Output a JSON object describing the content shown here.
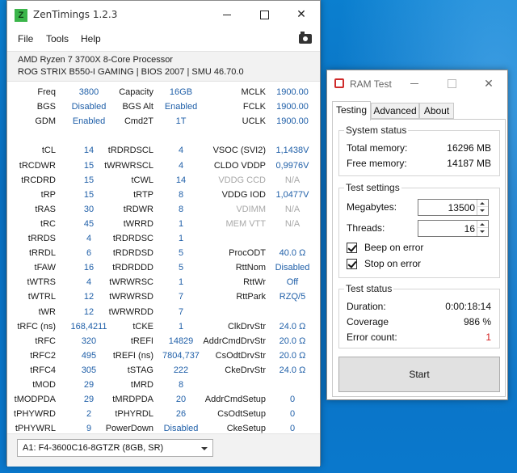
{
  "zentimings": {
    "title": "ZenTimings 1.2.3",
    "logo_letter": "Z",
    "menu": [
      "File",
      "Tools",
      "Help"
    ],
    "cpu": "AMD Ryzen 7 3700X 8-Core Processor",
    "board": "ROG STRIX B550-I GAMING | BIOS 2007 | SMU 46.70.0",
    "col1": [
      {
        "label": "Freq",
        "value": "3800"
      },
      {
        "label": "BGS",
        "value": "Disabled"
      },
      {
        "label": "GDM",
        "value": "Enabled"
      },
      {
        "label": "",
        "value": ""
      },
      {
        "label": "tCL",
        "value": "14"
      },
      {
        "label": "tRCDWR",
        "value": "15"
      },
      {
        "label": "tRCDRD",
        "value": "15"
      },
      {
        "label": "tRP",
        "value": "15"
      },
      {
        "label": "tRAS",
        "value": "30"
      },
      {
        "label": "tRC",
        "value": "45"
      },
      {
        "label": "tRRDS",
        "value": "4"
      },
      {
        "label": "tRRDL",
        "value": "6"
      },
      {
        "label": "tFAW",
        "value": "16"
      },
      {
        "label": "tWTRS",
        "value": "4"
      },
      {
        "label": "tWTRL",
        "value": "12"
      },
      {
        "label": "tWR",
        "value": "12"
      },
      {
        "label": "tRFC (ns)",
        "value": "168,4211"
      },
      {
        "label": "tRFC",
        "value": "320"
      },
      {
        "label": "tRFC2",
        "value": "495"
      },
      {
        "label": "tRFC4",
        "value": "305"
      },
      {
        "label": "tMOD",
        "value": "29"
      },
      {
        "label": "tMODPDA",
        "value": "29"
      },
      {
        "label": "tPHYWRD",
        "value": "2"
      },
      {
        "label": "tPHYWRL",
        "value": "9"
      }
    ],
    "col2": [
      {
        "label": "Capacity",
        "value": "16GB"
      },
      {
        "label": "BGS Alt",
        "value": "Enabled"
      },
      {
        "label": "Cmd2T",
        "value": "1T"
      },
      {
        "label": "",
        "value": ""
      },
      {
        "label": "tRDRDSCL",
        "value": "4"
      },
      {
        "label": "tWRWRSCL",
        "value": "4"
      },
      {
        "label": "tCWL",
        "value": "14"
      },
      {
        "label": "tRTP",
        "value": "8"
      },
      {
        "label": "tRDWR",
        "value": "8"
      },
      {
        "label": "tWRRD",
        "value": "1"
      },
      {
        "label": "tRDRDSC",
        "value": "1"
      },
      {
        "label": "tRDRDSD",
        "value": "5"
      },
      {
        "label": "tRDRDDD",
        "value": "5"
      },
      {
        "label": "tWRWRSC",
        "value": "1"
      },
      {
        "label": "tWRWRSD",
        "value": "7"
      },
      {
        "label": "tWRWRDD",
        "value": "7"
      },
      {
        "label": "tCKE",
        "value": "1"
      },
      {
        "label": "tREFI",
        "value": "14829"
      },
      {
        "label": "tREFI (ns)",
        "value": "7804,737"
      },
      {
        "label": "tSTAG",
        "value": "222"
      },
      {
        "label": "tMRD",
        "value": "8"
      },
      {
        "label": "tMRDPDA",
        "value": "20"
      },
      {
        "label": "tPHYRDL",
        "value": "26"
      },
      {
        "label": "PowerDown",
        "value": "Disabled"
      }
    ],
    "col3": [
      {
        "label": "MCLK",
        "value": "1900.00",
        "disabled": false
      },
      {
        "label": "FCLK",
        "value": "1900.00",
        "disabled": false
      },
      {
        "label": "UCLK",
        "value": "1900.00",
        "disabled": false
      },
      {
        "label": "",
        "value": "",
        "disabled": false
      },
      {
        "label": "VSOC (SVI2)",
        "value": "1,1438V",
        "disabled": false
      },
      {
        "label": "CLDO VDDP",
        "value": "0,9976V",
        "disabled": false
      },
      {
        "label": "VDDG CCD",
        "value": "N/A",
        "disabled": true
      },
      {
        "label": "VDDG IOD",
        "value": "1,0477V",
        "disabled": false
      },
      {
        "label": "VDIMM",
        "value": "N/A",
        "disabled": true
      },
      {
        "label": "MEM VTT",
        "value": "N/A",
        "disabled": true
      },
      {
        "label": "",
        "value": "",
        "disabled": false
      },
      {
        "label": "ProcODT",
        "value": "40.0 Ω",
        "disabled": false
      },
      {
        "label": "RttNom",
        "value": "Disabled",
        "disabled": false
      },
      {
        "label": "RttWr",
        "value": "Off",
        "disabled": false
      },
      {
        "label": "RttPark",
        "value": "RZQ/5",
        "disabled": false
      },
      {
        "label": "",
        "value": "",
        "disabled": false
      },
      {
        "label": "ClkDrvStr",
        "value": "24.0 Ω",
        "disabled": false
      },
      {
        "label": "AddrCmdDrvStr",
        "value": "20.0 Ω",
        "disabled": false
      },
      {
        "label": "CsOdtDrvStr",
        "value": "20.0 Ω",
        "disabled": false
      },
      {
        "label": "CkeDrvStr",
        "value": "24.0 Ω",
        "disabled": false
      },
      {
        "label": "",
        "value": "",
        "disabled": false
      },
      {
        "label": "AddrCmdSetup",
        "value": "0",
        "disabled": false
      },
      {
        "label": "CsOdtSetup",
        "value": "0",
        "disabled": false
      },
      {
        "label": "CkeSetup",
        "value": "0",
        "disabled": false
      }
    ],
    "module_select": "A1: F4-3600C16-8GTZR (8GB, SR)"
  },
  "ramtest": {
    "title": "RAM Test",
    "tabs": [
      "Testing",
      "Advanced",
      "About"
    ],
    "system_status": {
      "title": "System status",
      "total_label": "Total memory:",
      "total_value": "16296 MB",
      "free_label": "Free memory:",
      "free_value": "14187 MB"
    },
    "test_settings": {
      "title": "Test settings",
      "megabytes_label": "Megabytes:",
      "megabytes_value": "13500",
      "threads_label": "Threads:",
      "threads_value": "16",
      "beep_label": "Beep on error",
      "stop_label": "Stop on error"
    },
    "test_status": {
      "title": "Test status",
      "duration_label": "Duration:",
      "duration_value": "0:00:18:14",
      "coverage_label": "Coverage",
      "coverage_value": "986 %",
      "errors_label": "Error count:",
      "errors_value": "1"
    },
    "start_label": "Start"
  },
  "colors": {
    "value_blue": "#1f5fa8",
    "error_red": "#d11a1a",
    "disabled_gray": "#a8a8a8",
    "desktop_blue": "#0a6fc0"
  }
}
